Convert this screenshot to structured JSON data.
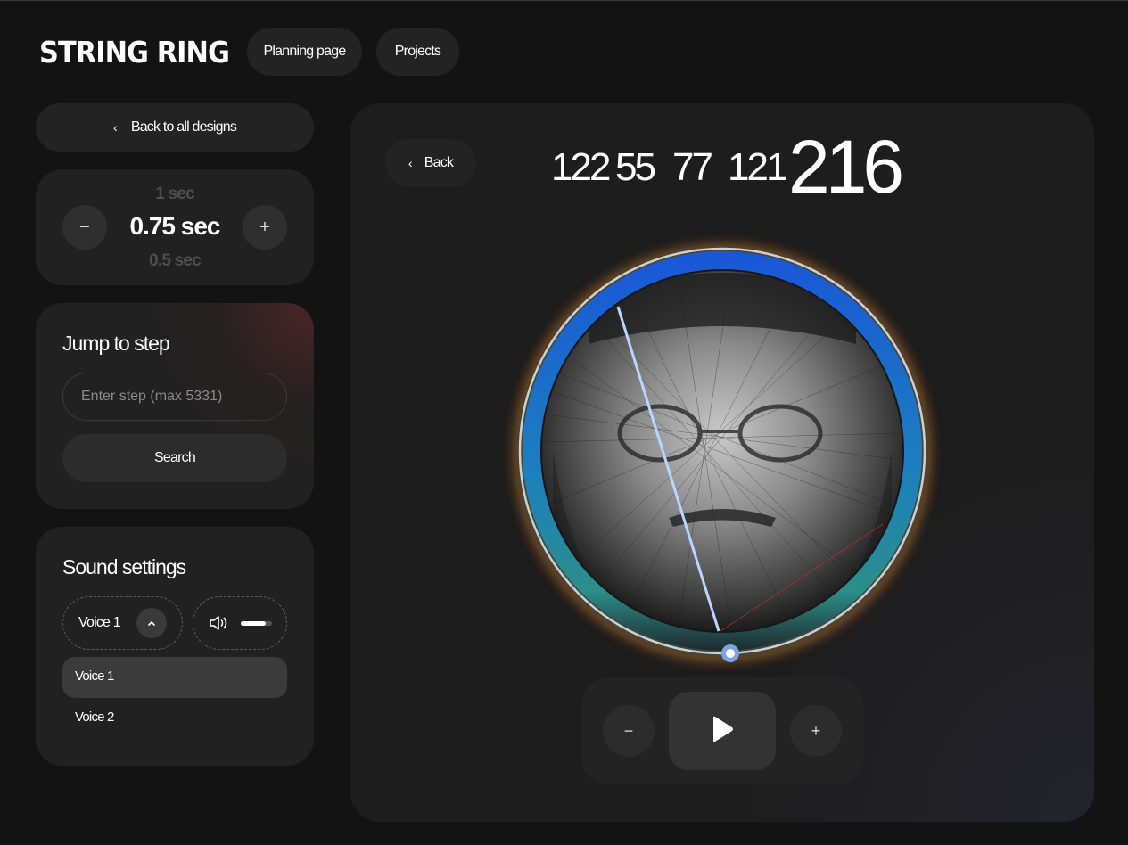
{
  "app": {
    "logo": "STRING RING",
    "nav": [
      {
        "label": "Planning page"
      },
      {
        "label": "Projects"
      }
    ]
  },
  "sidebar": {
    "back_label": "Back to all designs",
    "speed": {
      "prev": "1 sec",
      "current": "0.75 sec",
      "next": "0.5 sec",
      "minus": "−",
      "plus": "+"
    },
    "jump": {
      "title": "Jump to step",
      "placeholder": "Enter step (max 5331)",
      "button": "Search"
    },
    "sound": {
      "title": "Sound settings",
      "voice_selected": "Voice 1",
      "volume_level": 0.8,
      "options": [
        {
          "label": "Voice 1",
          "active": true
        },
        {
          "label": "Voice 2",
          "active": false
        }
      ]
    }
  },
  "main": {
    "back_label": "Back",
    "steps": [
      "122",
      "55",
      "77",
      "121"
    ],
    "current_step": "216",
    "controls": {
      "minus": "−",
      "plus": "+"
    }
  },
  "colors": {
    "background": "#131313",
    "card": "#212121",
    "ring_blue": "#1e5fcf",
    "thread_highlight": "#b8d6ff",
    "accent_red": "#b03030"
  },
  "icons": [
    "chevron-left-icon",
    "chevron-up-icon",
    "speaker-icon",
    "play-icon"
  ]
}
